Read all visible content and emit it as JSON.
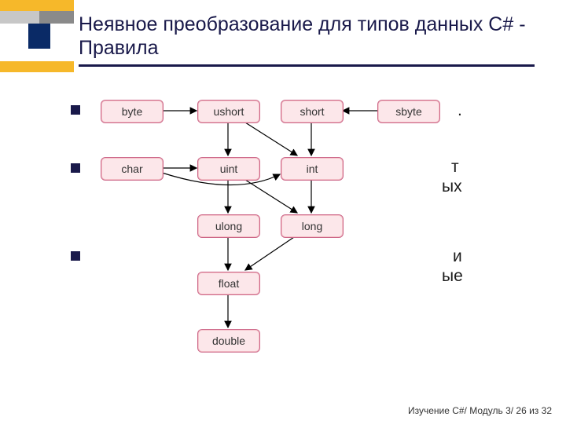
{
  "title": "Неявное преобразование для типов данных C# - Правила",
  "bullets": {
    "frag1": ".",
    "frag2a": "т",
    "frag2b": "ых",
    "frag3a": "и",
    "frag3b": "ые"
  },
  "nodes": {
    "byte": "byte",
    "ushort": "ushort",
    "short": "short",
    "sbyte": "sbyte",
    "char": "char",
    "uint": "uint",
    "int": "int",
    "ulong": "ulong",
    "long": "long",
    "float": "float",
    "double": "double"
  },
  "footer": "Изучение C#/ Модуль 3/ 26 из 32",
  "chart_data": {
    "type": "diagram",
    "title": "Implicit numeric conversions in C#",
    "annotations": [],
    "nodes": [
      "byte",
      "ushort",
      "short",
      "sbyte",
      "char",
      "uint",
      "int",
      "ulong",
      "long",
      "float",
      "double"
    ],
    "edges": [
      [
        "byte",
        "ushort"
      ],
      [
        "sbyte",
        "short"
      ],
      [
        "ushort",
        "uint"
      ],
      [
        "ushort",
        "int"
      ],
      [
        "short",
        "int"
      ],
      [
        "char",
        "uint"
      ],
      [
        "char",
        "int"
      ],
      [
        "uint",
        "ulong"
      ],
      [
        "uint",
        "long"
      ],
      [
        "int",
        "long"
      ],
      [
        "ulong",
        "float"
      ],
      [
        "long",
        "float"
      ],
      [
        "float",
        "double"
      ]
    ]
  }
}
